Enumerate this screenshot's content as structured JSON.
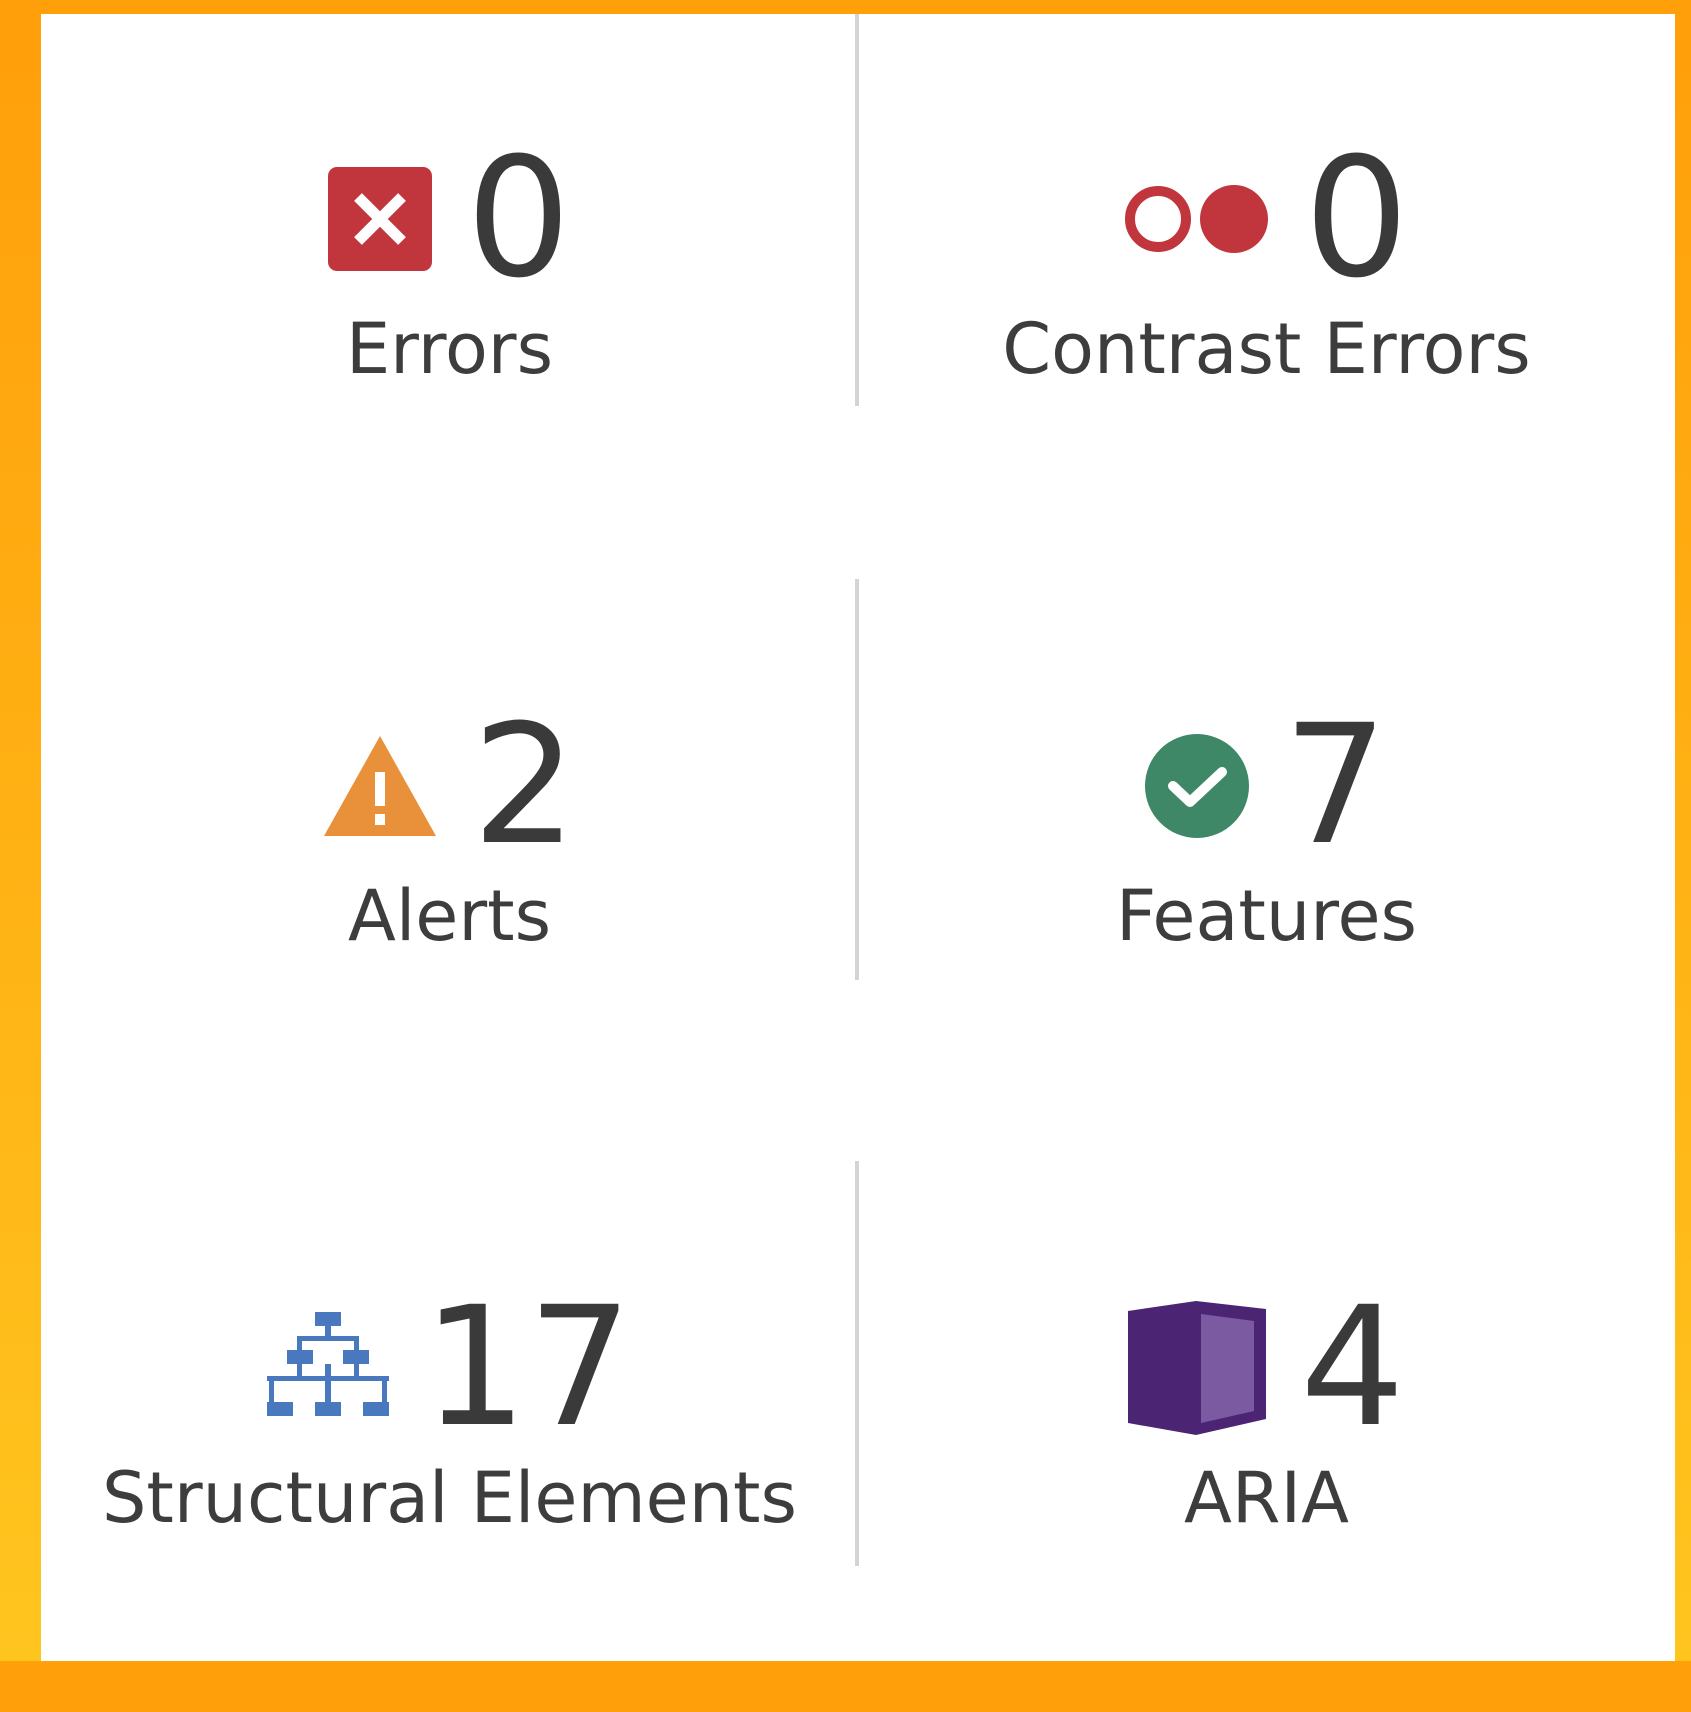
{
  "summary": {
    "items": [
      {
        "name": "errors",
        "label": "Errors",
        "count": "0",
        "icon": "error-x-icon",
        "color": "#c1363d"
      },
      {
        "name": "contrast-errors",
        "label": "Contrast Errors",
        "count": "0",
        "icon": "contrast-icon",
        "color": "#c1363d"
      },
      {
        "name": "alerts",
        "label": "Alerts",
        "count": "2",
        "icon": "alert-triangle-icon",
        "color": "#e8913a"
      },
      {
        "name": "features",
        "label": "Features",
        "count": "7",
        "icon": "check-circle-icon",
        "color": "#3e8767"
      },
      {
        "name": "structural-elements",
        "label": "Structural Elements",
        "count": "17",
        "icon": "hierarchy-icon",
        "color": "#4a78be"
      },
      {
        "name": "aria",
        "label": "ARIA",
        "count": "4",
        "icon": "aria-box-icon",
        "color": "#4b2573"
      }
    ]
  }
}
